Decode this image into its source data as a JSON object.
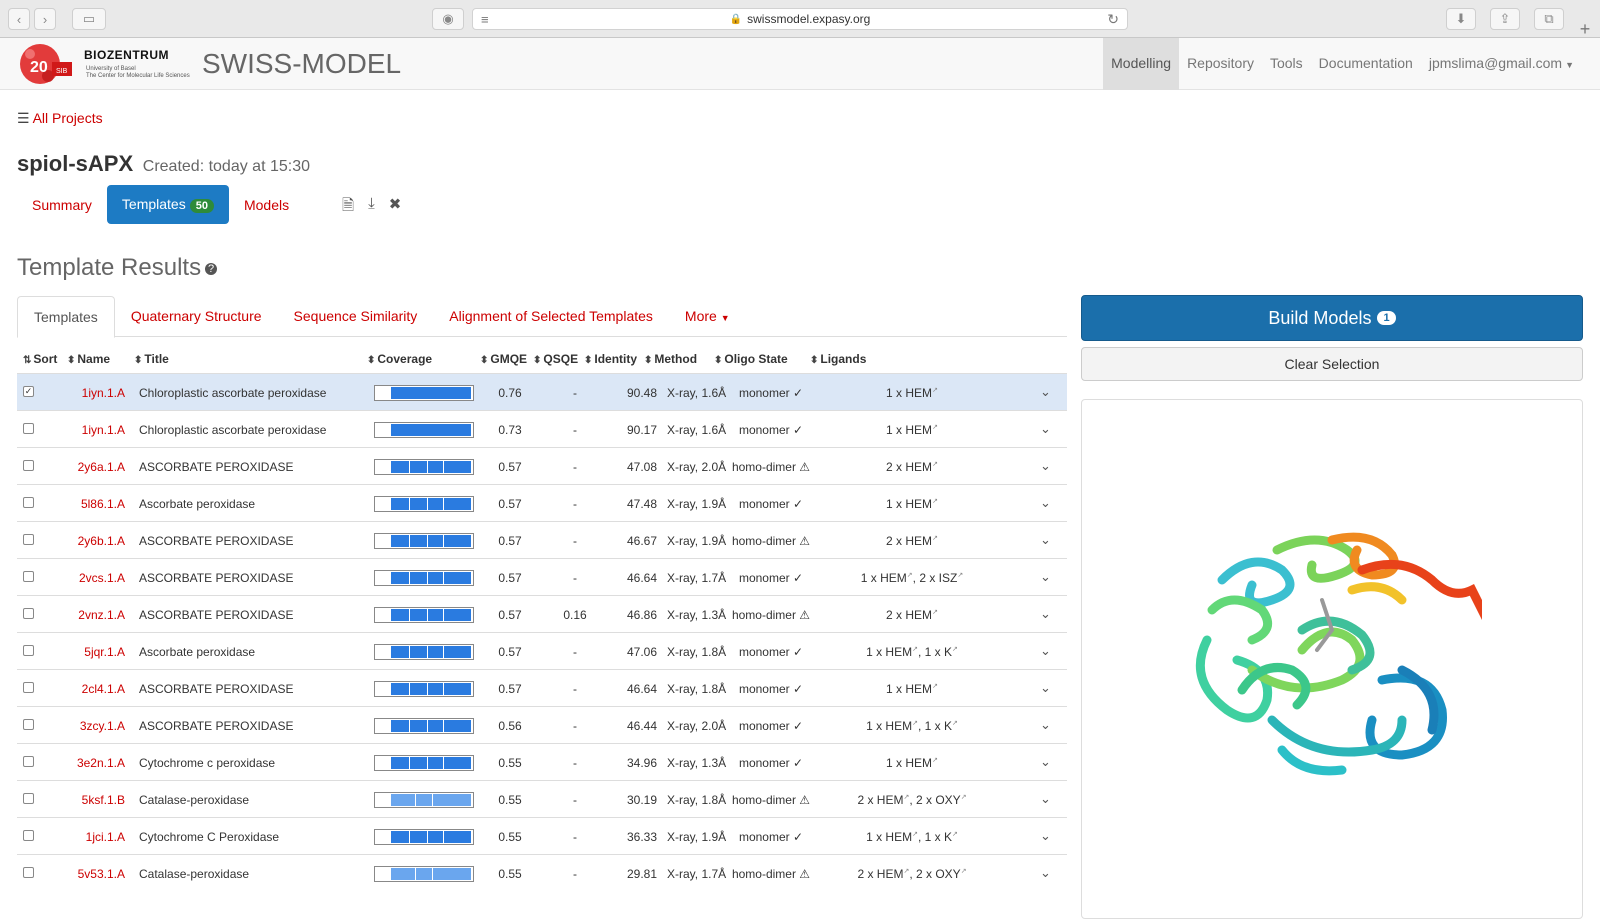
{
  "browser": {
    "url": "swissmodel.expasy.org"
  },
  "header": {
    "logo_number": "20",
    "logo_sub": "SIB",
    "biozentrum": "BIOZENTRUM",
    "biozentrum_sub1": "University of Basel",
    "biozentrum_sub2": "The Center for Molecular Life Sciences",
    "brand": "SWISS-MODEL",
    "nav": [
      "Modelling",
      "Repository",
      "Tools",
      "Documentation",
      "jpmslima@gmail.com"
    ]
  },
  "breadcrumb": {
    "all_projects": "All Projects"
  },
  "project": {
    "name": "spiol-sAPX",
    "created": "Created: today at 15:30"
  },
  "project_tabs": {
    "summary": "Summary",
    "templates": "Templates",
    "templates_count": "50",
    "models": "Models"
  },
  "results": {
    "title": "Template Results",
    "tabs": [
      "Templates",
      "Quaternary Structure",
      "Sequence Similarity",
      "Alignment of Selected Templates",
      "More"
    ]
  },
  "table": {
    "headers": [
      "Sort",
      "Name",
      "Title",
      "Coverage",
      "GMQE",
      "QSQE",
      "Identity",
      "Method",
      "Oligo State",
      "Ligands"
    ],
    "rows": [
      {
        "name": "1iyn.1.A",
        "title": "Chloroplastic ascorbate peroxidase",
        "gmqe": "0.76",
        "qsqe": "-",
        "identity": "90.48",
        "method": "X-ray, 1.6Å",
        "oligo": "monomer ✓",
        "ligands": [
          "1 x HEM"
        ],
        "selected": true,
        "coverage": "full"
      },
      {
        "name": "1iyn.1.A",
        "title": "Chloroplastic ascorbate peroxidase",
        "gmqe": "0.73",
        "qsqe": "-",
        "identity": "90.17",
        "method": "X-ray, 1.6Å",
        "oligo": "monomer ✓",
        "ligands": [
          "1 x HEM"
        ],
        "selected": false,
        "coverage": "full"
      },
      {
        "name": "2y6a.1.A",
        "title": "ASCORBATE PEROXIDASE",
        "gmqe": "0.57",
        "qsqe": "-",
        "identity": "47.08",
        "method": "X-ray, 2.0Å",
        "oligo": "homo-dimer ⚠",
        "ligands": [
          "2 x HEM"
        ],
        "selected": false,
        "coverage": "split"
      },
      {
        "name": "5l86.1.A",
        "title": "Ascorbate peroxidase",
        "gmqe": "0.57",
        "qsqe": "-",
        "identity": "47.48",
        "method": "X-ray, 1.9Å",
        "oligo": "monomer ✓",
        "ligands": [
          "1 x HEM"
        ],
        "selected": false,
        "coverage": "split"
      },
      {
        "name": "2y6b.1.A",
        "title": "ASCORBATE PEROXIDASE",
        "gmqe": "0.57",
        "qsqe": "-",
        "identity": "46.67",
        "method": "X-ray, 1.9Å",
        "oligo": "homo-dimer ⚠",
        "ligands": [
          "2 x HEM"
        ],
        "selected": false,
        "coverage": "split"
      },
      {
        "name": "2vcs.1.A",
        "title": "ASCORBATE PEROXIDASE",
        "gmqe": "0.57",
        "qsqe": "-",
        "identity": "46.64",
        "method": "X-ray, 1.7Å",
        "oligo": "monomer ✓",
        "ligands": [
          "1 x HEM",
          "2 x ISZ"
        ],
        "selected": false,
        "coverage": "split"
      },
      {
        "name": "2vnz.1.A",
        "title": "ASCORBATE PEROXIDASE",
        "gmqe": "0.57",
        "qsqe": "0.16",
        "identity": "46.86",
        "method": "X-ray, 1.3Å",
        "oligo": "homo-dimer ⚠",
        "ligands": [
          "2 x HEM"
        ],
        "selected": false,
        "coverage": "split"
      },
      {
        "name": "5jqr.1.A",
        "title": "Ascorbate peroxidase",
        "gmqe": "0.57",
        "qsqe": "-",
        "identity": "47.06",
        "method": "X-ray, 1.8Å",
        "oligo": "monomer ✓",
        "ligands": [
          "1 x HEM",
          "1 x K"
        ],
        "selected": false,
        "coverage": "split"
      },
      {
        "name": "2cl4.1.A",
        "title": "ASCORBATE PEROXIDASE",
        "gmqe": "0.57",
        "qsqe": "-",
        "identity": "46.64",
        "method": "X-ray, 1.8Å",
        "oligo": "monomer ✓",
        "ligands": [
          "1 x HEM"
        ],
        "selected": false,
        "coverage": "split"
      },
      {
        "name": "3zcy.1.A",
        "title": "ASCORBATE PEROXIDASE",
        "gmqe": "0.56",
        "qsqe": "-",
        "identity": "46.44",
        "method": "X-ray, 2.0Å",
        "oligo": "monomer ✓",
        "ligands": [
          "1 x HEM",
          "1 x K"
        ],
        "selected": false,
        "coverage": "split"
      },
      {
        "name": "3e2n.1.A",
        "title": "Cytochrome c peroxidase",
        "gmqe": "0.55",
        "qsqe": "-",
        "identity": "34.96",
        "method": "X-ray, 1.3Å",
        "oligo": "monomer ✓",
        "ligands": [
          "1 x HEM"
        ],
        "selected": false,
        "coverage": "split"
      },
      {
        "name": "5ksf.1.B",
        "title": "Catalase-peroxidase",
        "gmqe": "0.55",
        "qsqe": "-",
        "identity": "30.19",
        "method": "X-ray, 1.8Å",
        "oligo": "homo-dimer ⚠",
        "ligands": [
          "2 x HEM",
          "2 x OXY"
        ],
        "selected": false,
        "coverage": "light"
      },
      {
        "name": "1jci.1.A",
        "title": "Cytochrome C Peroxidase",
        "gmqe": "0.55",
        "qsqe": "-",
        "identity": "36.33",
        "method": "X-ray, 1.9Å",
        "oligo": "monomer ✓",
        "ligands": [
          "1 x HEM",
          "1 x K"
        ],
        "selected": false,
        "coverage": "split"
      },
      {
        "name": "5v53.1.A",
        "title": "Catalase-peroxidase",
        "gmqe": "0.55",
        "qsqe": "-",
        "identity": "29.81",
        "method": "X-ray, 1.7Å",
        "oligo": "homo-dimer ⚠",
        "ligands": [
          "2 x HEM",
          "2 x OXY"
        ],
        "selected": false,
        "coverage": "light"
      }
    ]
  },
  "panel": {
    "build": "Build Models",
    "build_count": "1",
    "clear": "Clear Selection"
  },
  "colors": {
    "link": "#cc0000",
    "primary": "#1d7bc4",
    "badge": "#2e8b3a",
    "coverage": "#2a7be0",
    "selected_row": "#dbe7f6"
  },
  "icons": [
    "back-icon",
    "forward-icon",
    "sidebar-icon",
    "extension-icon",
    "reader-icon",
    "lock-icon",
    "reload-icon",
    "download-icon",
    "share-icon",
    "tabs-icon",
    "plus-icon",
    "list-icon",
    "file-icon",
    "save-icon",
    "close-icon",
    "help-icon",
    "caret-down-icon",
    "chevron-down-icon",
    "external-link-icon"
  ]
}
